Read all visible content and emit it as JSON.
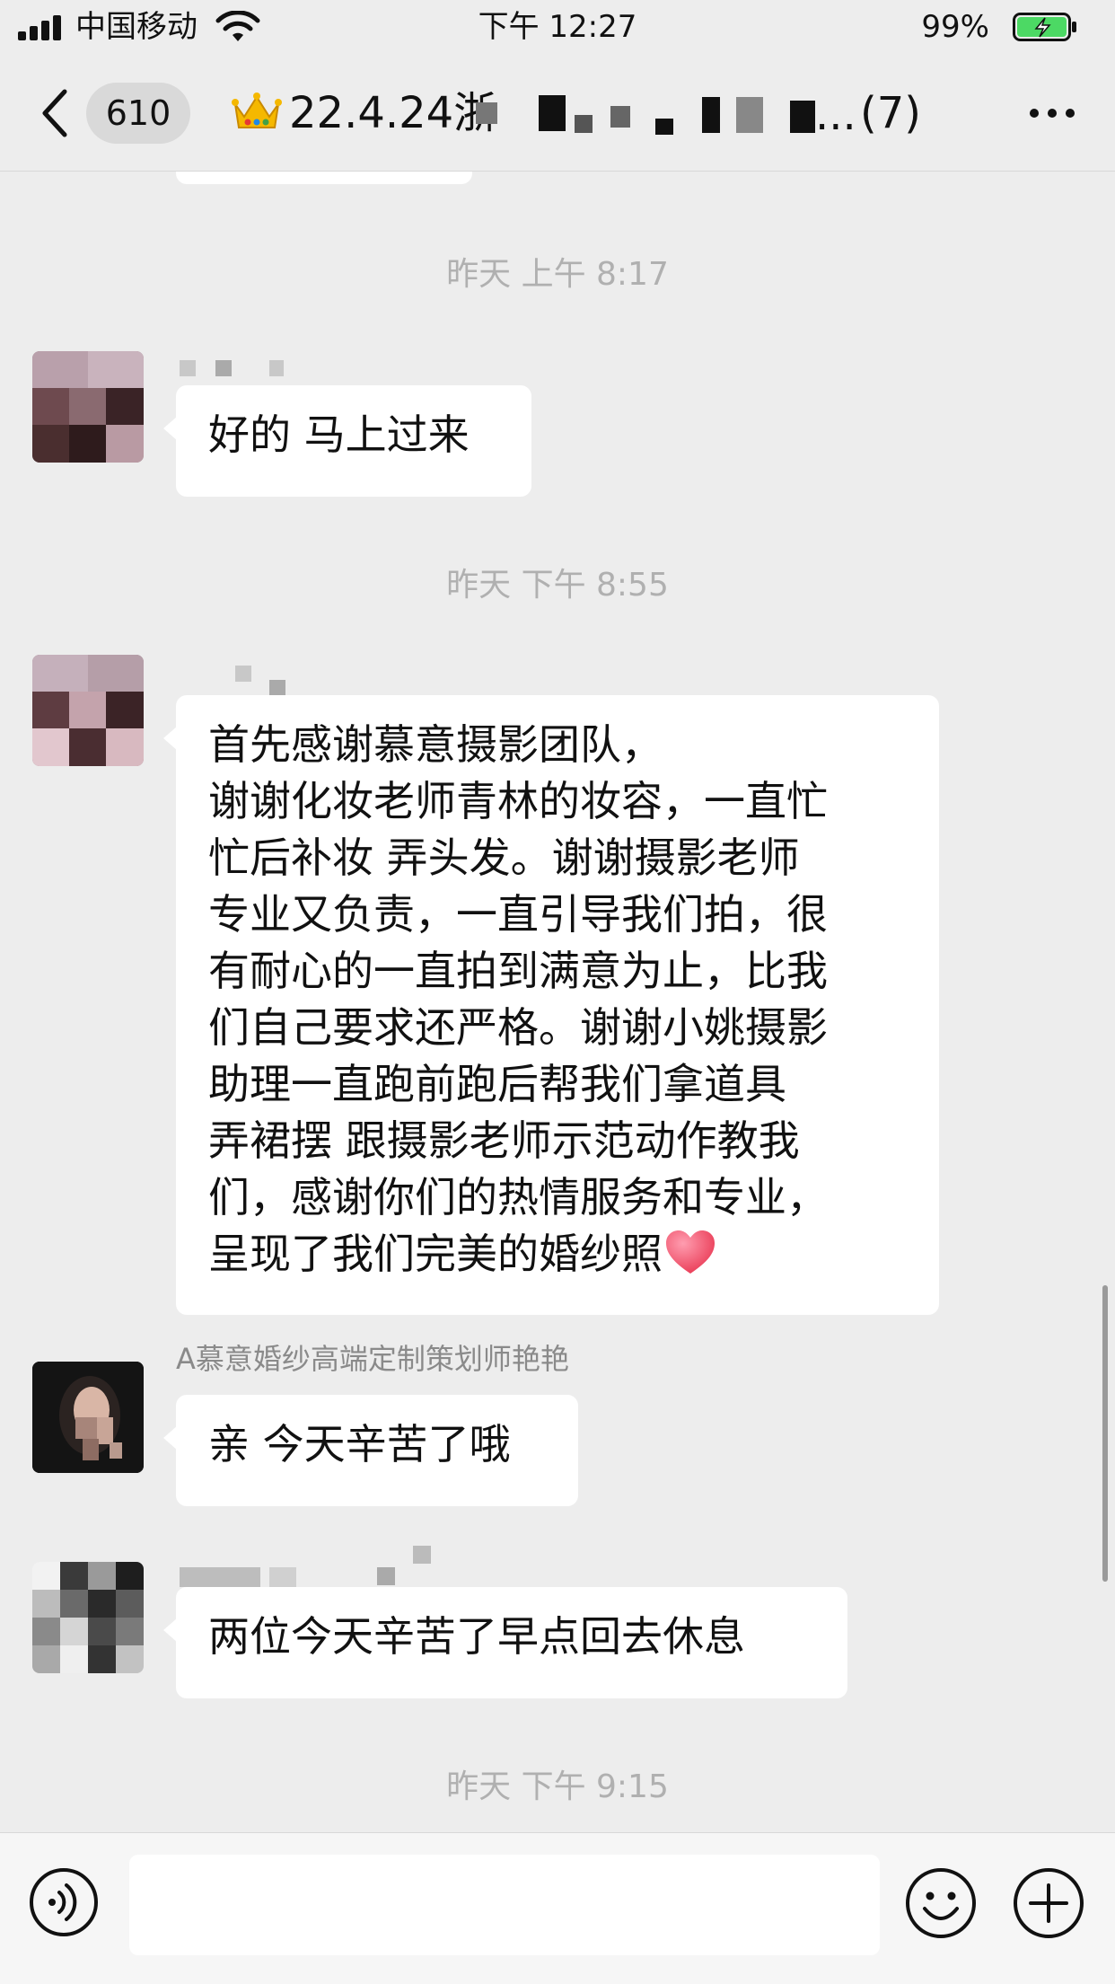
{
  "status_bar": {
    "carrier": "中国移动",
    "time": "下午 12:27",
    "battery": "99%"
  },
  "nav": {
    "unread_count": "610",
    "title_visible": "22.4.24",
    "title_partial_char": "浙",
    "member_count": "(7)",
    "title_ellipsis": "..."
  },
  "messages": {
    "timestamps": [
      "昨天 上午 8:17",
      "昨天 下午 8:55",
      "昨天 下午 9:15"
    ],
    "msg1": {
      "text": "好的 马上过来"
    },
    "msg2": {
      "lines": [
        "首先感谢慕意摄影团队，",
        "谢谢化妆老师青林的妆容，一直忙",
        "忙后补妆 弄头发。谢谢摄影老师",
        "专业又负责，一直引导我们拍，很",
        "有耐心的一直拍到满意为止，比我",
        "们自己要求还严格。谢谢小姚摄影",
        "助理一直跑前跑后帮我们拿道具",
        "弄裙摆 跟摄影老师示范动作教我",
        "们，感谢你们的热情服务和专业，",
        "呈现了我们完美的婚纱照"
      ]
    },
    "msg3": {
      "sender": "A慕意婚纱高端定制策划师艳艳",
      "text": "亲 今天辛苦了哦"
    },
    "msg4": {
      "text": "两位今天辛苦了早点回去休息"
    }
  },
  "input": {
    "placeholder": ""
  },
  "colors": {
    "background": "#ededed",
    "bubble": "#ffffff",
    "timestamp": "#b0b0b0",
    "battery": "#4cd964"
  },
  "icons": [
    "signal-icon",
    "wifi-icon",
    "battery-icon",
    "back-icon",
    "crown-icon",
    "more-icon",
    "heart-icon",
    "voice-icon",
    "emoji-icon",
    "add-icon"
  ]
}
